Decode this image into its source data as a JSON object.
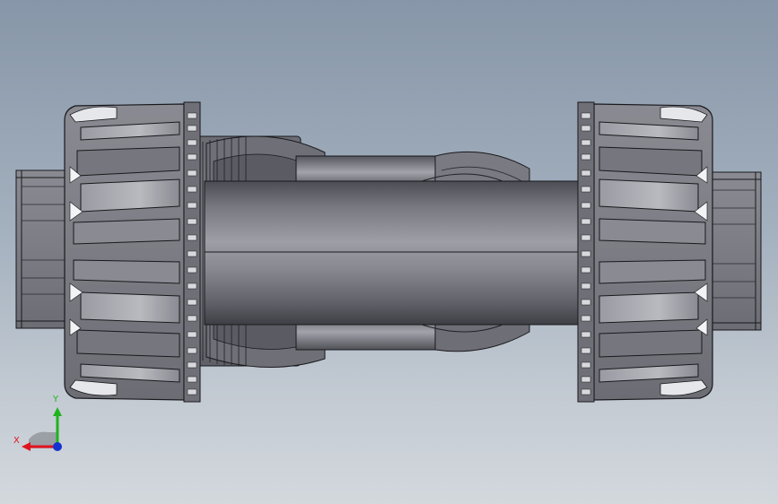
{
  "viewport": {
    "model": "union-valve-assembly",
    "background_top": "#8796a8",
    "background_bottom": "#d3d8dd",
    "part_color": "#7e7f86",
    "edge_color": "#18181c"
  },
  "triad": {
    "x_label": "X",
    "y_label": "Y",
    "x_color": "#e0141e",
    "y_color": "#1eb41e",
    "z_color": "#1432d2"
  }
}
